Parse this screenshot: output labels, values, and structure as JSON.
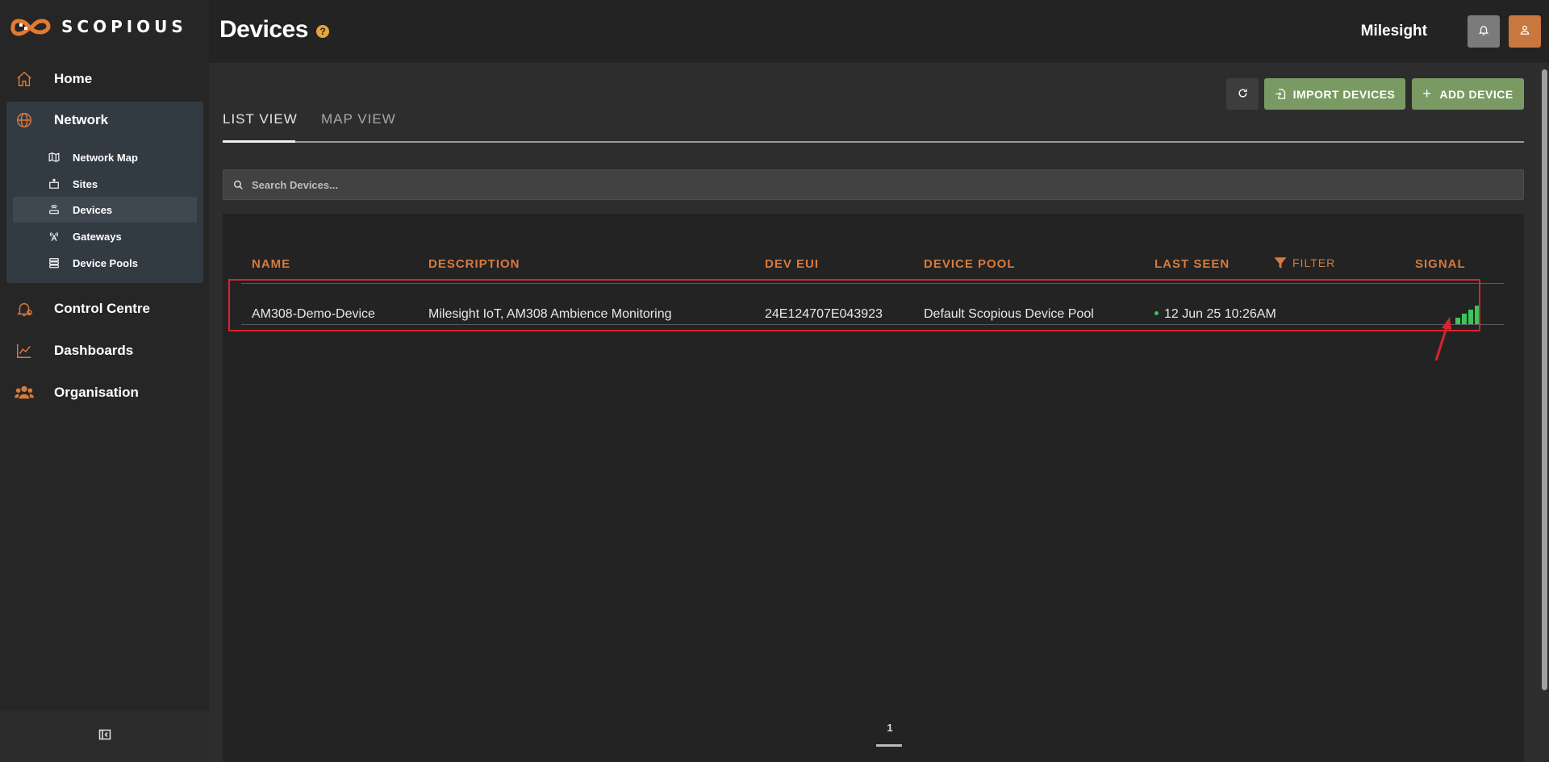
{
  "app": {
    "name": "SCOPIOUS"
  },
  "sidebar": {
    "items": [
      {
        "label": "Home"
      },
      {
        "label": "Network"
      },
      {
        "label": "Control Centre"
      },
      {
        "label": "Dashboards"
      },
      {
        "label": "Organisation"
      }
    ],
    "network_sub": [
      {
        "label": "Network Map"
      },
      {
        "label": "Sites"
      },
      {
        "label": "Devices"
      },
      {
        "label": "Gateways"
      },
      {
        "label": "Device Pools"
      }
    ]
  },
  "header": {
    "title": "Devices",
    "help": "?",
    "org": "Milesight"
  },
  "tabs": [
    {
      "label": "LIST VIEW"
    },
    {
      "label": "MAP VIEW"
    }
  ],
  "toolbar": {
    "import_label": "IMPORT DEVICES",
    "add_label": "ADD DEVICE"
  },
  "search": {
    "placeholder": "Search Devices..."
  },
  "table": {
    "columns": [
      "NAME",
      "DESCRIPTION",
      "DEV EUI",
      "DEVICE POOL",
      "LAST SEEN",
      "SIGNAL"
    ],
    "filter_label": "FILTER",
    "rows": [
      {
        "name": "AM308-Demo-Device",
        "description": "Milesight IoT, AM308 Ambience Monitoring",
        "dev_eui": "24E124707E043923",
        "device_pool": "Default Scopious Device Pool",
        "last_seen": "12 Jun 25 10:26AM",
        "signal_bars": 4
      }
    ]
  },
  "pagination": {
    "page": "1"
  },
  "colors": {
    "accent": "#d67b3f",
    "green_button": "#7a9a63",
    "signal_green": "#3cc45a",
    "highlight_red": "#d8242c"
  }
}
